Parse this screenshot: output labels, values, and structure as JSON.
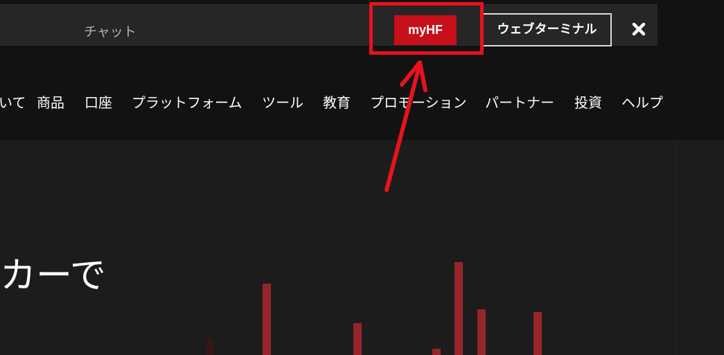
{
  "topbar": {
    "chat_label": "チャット",
    "myhf_label": "myHF",
    "web_terminal_label": "ウェブターミナル",
    "close_glyph": "✖"
  },
  "nav": {
    "items": [
      {
        "label": "いて"
      },
      {
        "label": "商品"
      },
      {
        "label": "口座"
      },
      {
        "label": "プラットフォーム"
      },
      {
        "label": "ツール"
      },
      {
        "label": "教育"
      },
      {
        "label": "プロモーション"
      },
      {
        "label": "パートナー"
      },
      {
        "label": "投資"
      },
      {
        "label": "ヘルプ"
      }
    ]
  },
  "hero": {
    "text": "カーで"
  },
  "colors": {
    "accent_red": "#c8101a",
    "annotation_red": "#e8121d",
    "topbar_bg": "#262626",
    "nav_bg": "#121212",
    "hero_bg": "#1c1c1c"
  }
}
